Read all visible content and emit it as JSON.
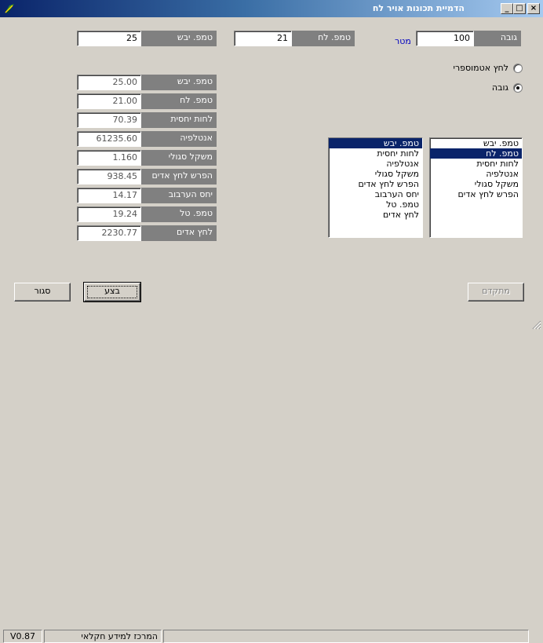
{
  "window": {
    "title": "הדמיית תכונות אויר לח",
    "minimize_glyph": "_",
    "maximize_glyph": "□",
    "close_glyph": "×",
    "icon": "app-leaf-icon"
  },
  "top_inputs": {
    "height_label": "גובה",
    "height_value": "100",
    "height_unit": "מטר",
    "wet_label": "טמפ. לח",
    "wet_value": "21",
    "dry_label": "טמפ. יבש",
    "dry_value": "25"
  },
  "mode": {
    "option_pressure": "לחץ אטמוספרי",
    "option_height": "גובה",
    "selected": "option_height"
  },
  "results": [
    {
      "label": "טמפ. יבש",
      "value": "25.00"
    },
    {
      "label": "טמפ. לח",
      "value": "21.00"
    },
    {
      "label": "לחות יחסית",
      "value": "70.39"
    },
    {
      "label": "אנטלפיה",
      "value": "61235.60"
    },
    {
      "label": "משקל סגולי",
      "value": "1.160"
    },
    {
      "label": "הפרש לחץ אדים",
      "value": "938.45"
    },
    {
      "label": "יחס הערבוב",
      "value": "14.17"
    },
    {
      "label": "טמפ. טל",
      "value": "19.24"
    },
    {
      "label": "לחץ אדים",
      "value": "2230.77"
    }
  ],
  "list_right": {
    "items": [
      "טמפ. יבש",
      "טמפ. לח",
      "לחות יחסית",
      "אנטלפיה",
      "משקל סגולי",
      "הפרש לחץ אדים"
    ],
    "selected_index": 1
  },
  "list_left": {
    "items": [
      "טמפ. יבש",
      "לחות יחסית",
      "אנטלפיה",
      "משקל סגולי",
      "הפרש לחץ אדים",
      "יחס הערבוב",
      "טמפ. טל",
      "לחץ אדים"
    ],
    "selected_index": 0
  },
  "buttons": {
    "close": "סגור",
    "execute": "בצע",
    "advanced": "מתקדם"
  },
  "status": {
    "version": "V0.87",
    "center": "המרכז למידע חקלאי",
    "right": ""
  },
  "colors": {
    "title_start": "#0a246a",
    "title_end": "#a6caf0",
    "label_bg": "#808080",
    "selection": "#0a246a",
    "unit_text": "#0000c0"
  }
}
